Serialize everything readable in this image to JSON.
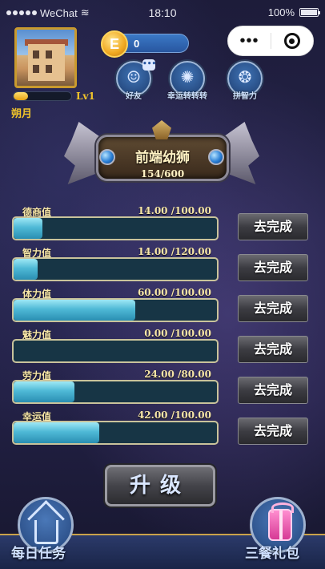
{
  "status_bar": {
    "carrier": "WeChat",
    "time": "18:10",
    "battery": "100%"
  },
  "profile": {
    "level": "Lv1",
    "name": "朔月",
    "xp_fraction": 0.25
  },
  "currency": {
    "amount": "0",
    "coin_letter": "E"
  },
  "top_buttons": [
    {
      "label": "好友",
      "icon": "person-icon",
      "badge": "•••"
    },
    {
      "label": "幸运转转转",
      "icon": "wheel-icon"
    },
    {
      "label": "拼智力",
      "icon": "brain-icon"
    }
  ],
  "title_banner": {
    "title": "前端幼狮",
    "progress": "154/600"
  },
  "stats": [
    {
      "label": "德商值",
      "value": "14.00 /100.00",
      "fraction": 0.14,
      "action": "去完成"
    },
    {
      "label": "智力值",
      "value": "14.00 /120.00",
      "fraction": 0.117,
      "action": "去完成"
    },
    {
      "label": "体力值",
      "value": "60.00 /100.00",
      "fraction": 0.6,
      "action": "去完成"
    },
    {
      "label": "魅力值",
      "value": "0.00 /100.00",
      "fraction": 0.0,
      "action": "去完成"
    },
    {
      "label": "劳力值",
      "value": "24.00 /80.00",
      "fraction": 0.3,
      "action": "去完成"
    },
    {
      "label": "幸运值",
      "value": "42.00 /100.00",
      "fraction": 0.42,
      "action": "去完成"
    }
  ],
  "upgrade_label": "升级",
  "bottom": {
    "left_label": "每日任务",
    "right_label": "三餐礼包"
  }
}
